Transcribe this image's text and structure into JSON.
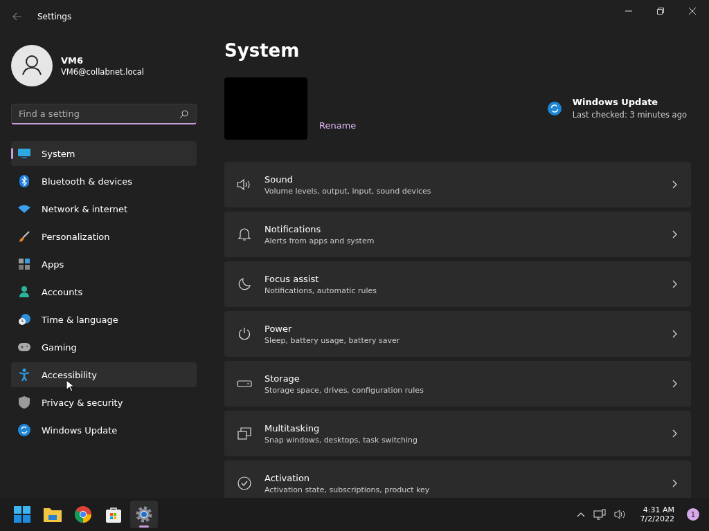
{
  "window": {
    "title": "Settings"
  },
  "account": {
    "name": "VM6",
    "email": "VM6@collabnet.local"
  },
  "search": {
    "placeholder": "Find a setting"
  },
  "sidebar": {
    "items": [
      {
        "label": "System",
        "selected": true,
        "hovered": false
      },
      {
        "label": "Bluetooth & devices",
        "selected": false,
        "hovered": false
      },
      {
        "label": "Network & internet",
        "selected": false,
        "hovered": false
      },
      {
        "label": "Personalization",
        "selected": false,
        "hovered": false
      },
      {
        "label": "Apps",
        "selected": false,
        "hovered": false
      },
      {
        "label": "Accounts",
        "selected": false,
        "hovered": false
      },
      {
        "label": "Time & language",
        "selected": false,
        "hovered": false
      },
      {
        "label": "Gaming",
        "selected": false,
        "hovered": false
      },
      {
        "label": "Accessibility",
        "selected": false,
        "hovered": true
      },
      {
        "label": "Privacy & security",
        "selected": false,
        "hovered": false
      },
      {
        "label": "Windows Update",
        "selected": false,
        "hovered": false
      }
    ]
  },
  "page": {
    "title": "System",
    "rename": "Rename",
    "update": {
      "title": "Windows Update",
      "status": "Last checked: 3 minutes ago"
    }
  },
  "cards": [
    {
      "title": "Sound",
      "description": "Volume levels, output, input, sound devices"
    },
    {
      "title": "Notifications",
      "description": "Alerts from apps and system"
    },
    {
      "title": "Focus assist",
      "description": "Notifications, automatic rules"
    },
    {
      "title": "Power",
      "description": "Sleep, battery usage, battery saver"
    },
    {
      "title": "Storage",
      "description": "Storage space, drives, configuration rules"
    },
    {
      "title": "Multitasking",
      "description": "Snap windows, desktops, task switching"
    },
    {
      "title": "Activation",
      "description": "Activation state, subscriptions, product key"
    }
  ],
  "taskbar": {
    "apps": [
      {
        "selected": false
      },
      {
        "selected": false
      },
      {
        "selected": false
      },
      {
        "selected": false
      },
      {
        "selected": true
      }
    ],
    "time": "4:31 AM",
    "date": "7/2/2022",
    "notifications": "1"
  }
}
